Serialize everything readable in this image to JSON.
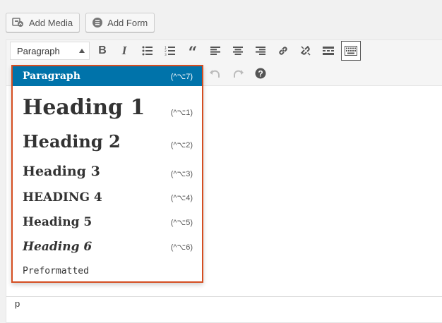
{
  "media_buttons": [
    {
      "label": "Add Media",
      "icon": "add-media-icon"
    },
    {
      "label": "Add Form",
      "icon": "add-form-icon"
    }
  ],
  "toolbar": {
    "format_select_value": "Paragraph",
    "buttons": [
      "bold-icon",
      "italic-icon",
      "bulleted-list-icon",
      "numbered-list-icon",
      "blockquote-icon",
      "align-left-icon",
      "align-center-icon",
      "align-right-icon",
      "insert-link-icon",
      "remove-link-icon",
      "read-more-icon",
      "toolbar-toggle-icon",
      "undo-icon",
      "redo-icon",
      "help-icon"
    ]
  },
  "format_dropdown": {
    "items": [
      {
        "label": "Paragraph",
        "shortcut": "(^⌥7)",
        "selected": true
      },
      {
        "label": "Heading 1",
        "shortcut": "(^⌥1)"
      },
      {
        "label": "Heading 2",
        "shortcut": "(^⌥2)"
      },
      {
        "label": "Heading 3",
        "shortcut": "(^⌥3)"
      },
      {
        "label": "Heading 4",
        "shortcut": "(^⌥4)"
      },
      {
        "label": "Heading 5",
        "shortcut": "(^⌥5)"
      },
      {
        "label": "Heading 6",
        "shortcut": "(^⌥6)"
      },
      {
        "label": "Preformatted",
        "shortcut": ""
      }
    ]
  },
  "status_path": "p",
  "colors": {
    "selected_bg": "#0073aa",
    "dropdown_border": "#d54e21"
  }
}
